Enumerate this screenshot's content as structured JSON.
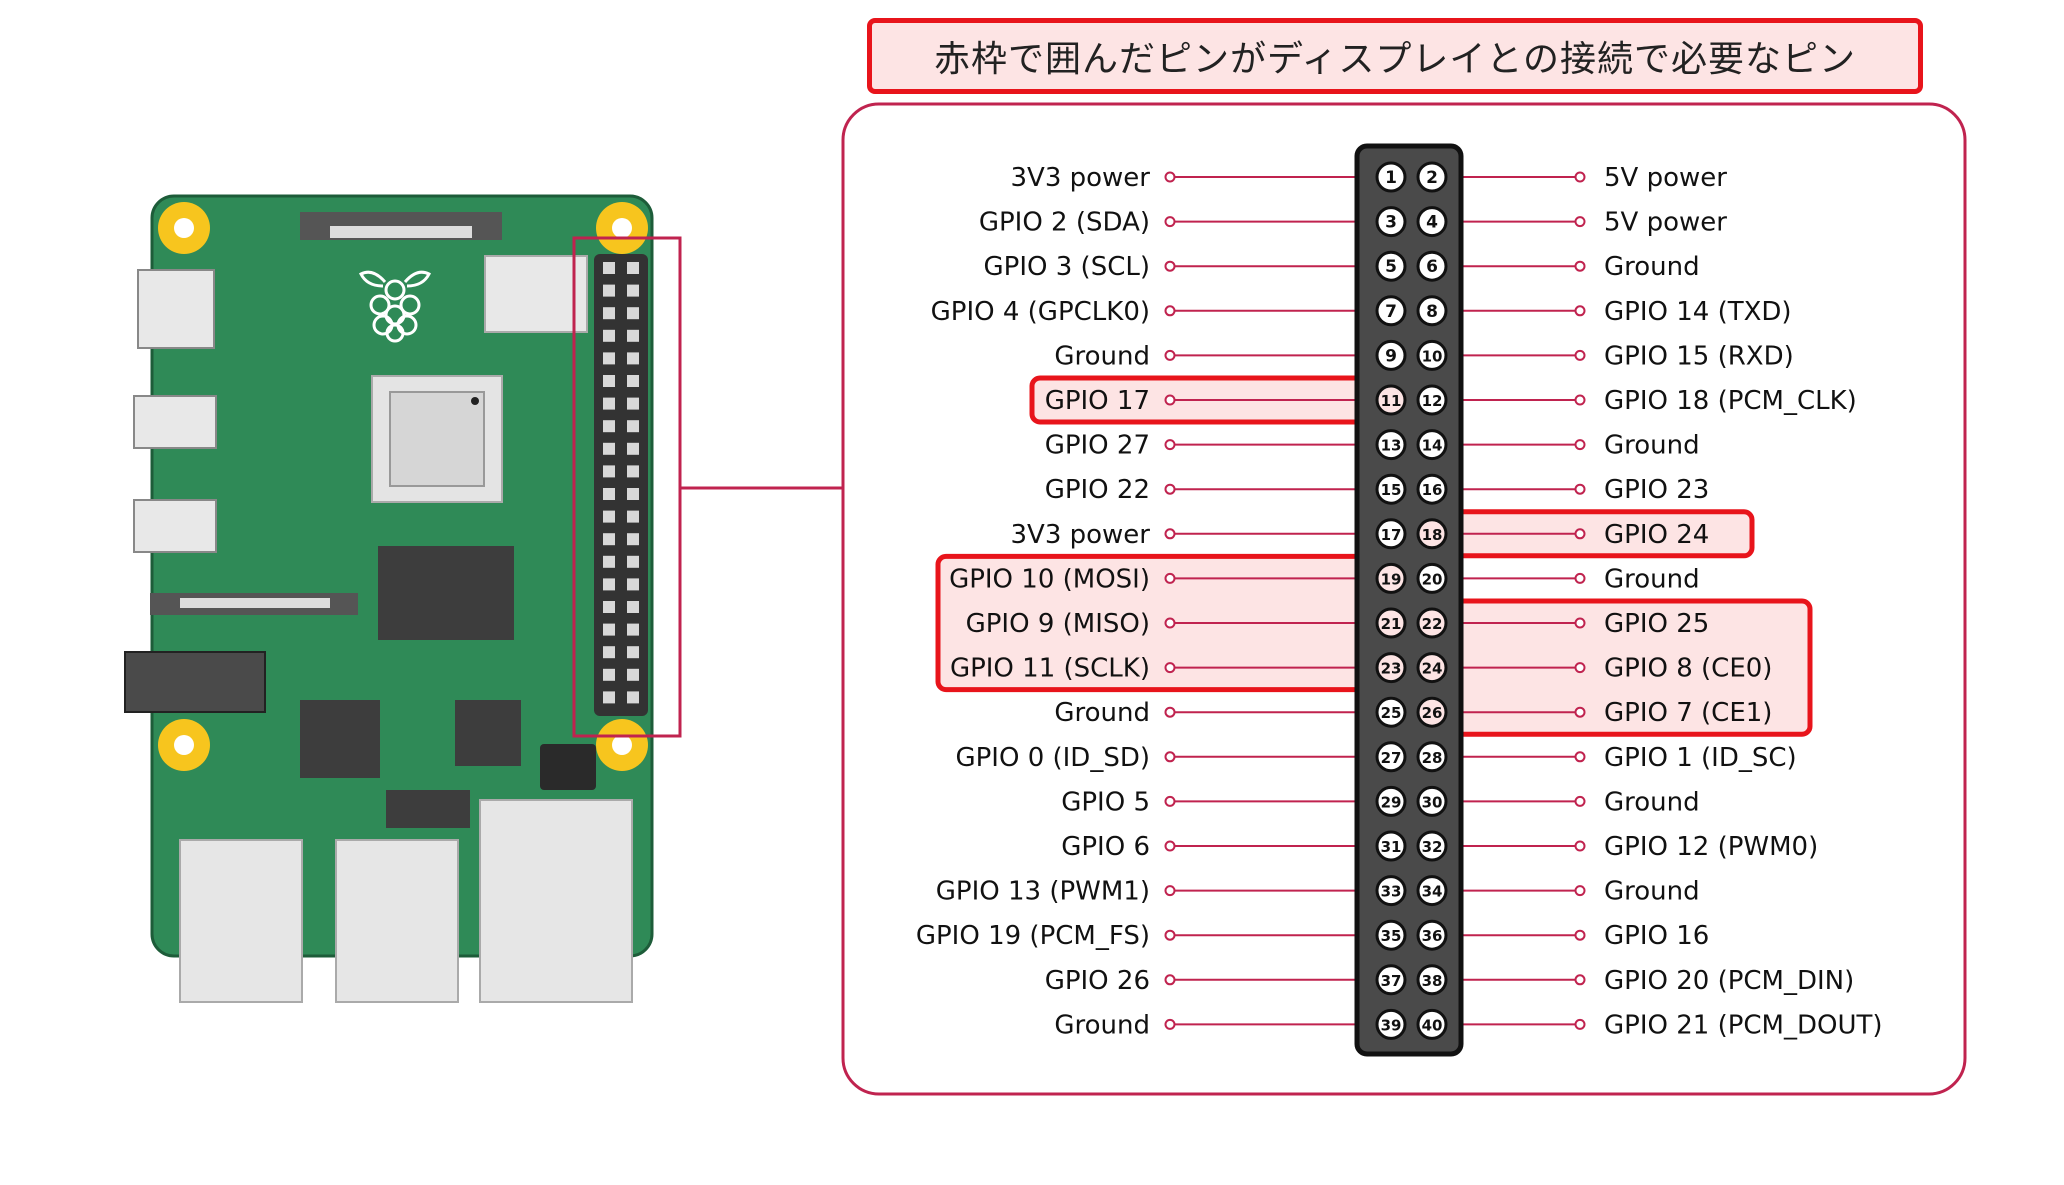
{
  "caption": "赤枠で囲んだピンがディスプレイとの接続で必要なピン",
  "colors": {
    "highlight_border": "#e8141b",
    "highlight_fill": "#fde4e4",
    "panel_border": "#c0234f",
    "header_body": "#4a4a4a",
    "board_green": "#2f8a57",
    "mount_hole": "#f7c51e"
  },
  "pins": [
    {
      "n": 1,
      "label": "3V3 power"
    },
    {
      "n": 2,
      "label": "5V power"
    },
    {
      "n": 3,
      "label": "GPIO 2 (SDA)"
    },
    {
      "n": 4,
      "label": "5V power"
    },
    {
      "n": 5,
      "label": "GPIO 3 (SCL)"
    },
    {
      "n": 6,
      "label": "Ground"
    },
    {
      "n": 7,
      "label": "GPIO 4 (GPCLK0)"
    },
    {
      "n": 8,
      "label": "GPIO 14 (TXD)"
    },
    {
      "n": 9,
      "label": "Ground"
    },
    {
      "n": 10,
      "label": "GPIO 15 (RXD)"
    },
    {
      "n": 11,
      "label": "GPIO 17"
    },
    {
      "n": 12,
      "label": "GPIO 18 (PCM_CLK)"
    },
    {
      "n": 13,
      "label": "GPIO 27"
    },
    {
      "n": 14,
      "label": "Ground"
    },
    {
      "n": 15,
      "label": "GPIO 22"
    },
    {
      "n": 16,
      "label": "GPIO 23"
    },
    {
      "n": 17,
      "label": "3V3 power"
    },
    {
      "n": 18,
      "label": "GPIO 24"
    },
    {
      "n": 19,
      "label": "GPIO 10 (MOSI)"
    },
    {
      "n": 20,
      "label": "Ground"
    },
    {
      "n": 21,
      "label": "GPIO 9 (MISO)"
    },
    {
      "n": 22,
      "label": "GPIO 25"
    },
    {
      "n": 23,
      "label": "GPIO 11 (SCLK)"
    },
    {
      "n": 24,
      "label": "GPIO 8 (CE0)"
    },
    {
      "n": 25,
      "label": "Ground"
    },
    {
      "n": 26,
      "label": "GPIO 7 (CE1)"
    },
    {
      "n": 27,
      "label": "GPIO 0 (ID_SD)"
    },
    {
      "n": 28,
      "label": "GPIO 1 (ID_SC)"
    },
    {
      "n": 29,
      "label": "GPIO 5"
    },
    {
      "n": 30,
      "label": "Ground"
    },
    {
      "n": 31,
      "label": "GPIO 6"
    },
    {
      "n": 32,
      "label": "GPIO 12 (PWM0)"
    },
    {
      "n": 33,
      "label": "GPIO 13 (PWM1)"
    },
    {
      "n": 34,
      "label": "Ground"
    },
    {
      "n": 35,
      "label": "GPIO 19 (PCM_FS)"
    },
    {
      "n": 36,
      "label": "GPIO 16"
    },
    {
      "n": 37,
      "label": "GPIO 26"
    },
    {
      "n": 38,
      "label": "GPIO 20 (PCM_DIN)"
    },
    {
      "n": 39,
      "label": "Ground"
    },
    {
      "n": 40,
      "label": "GPIO 21 (PCM_DOUT)"
    }
  ],
  "highlighted_pins": [
    11,
    18,
    19,
    21,
    22,
    23,
    24,
    26
  ]
}
